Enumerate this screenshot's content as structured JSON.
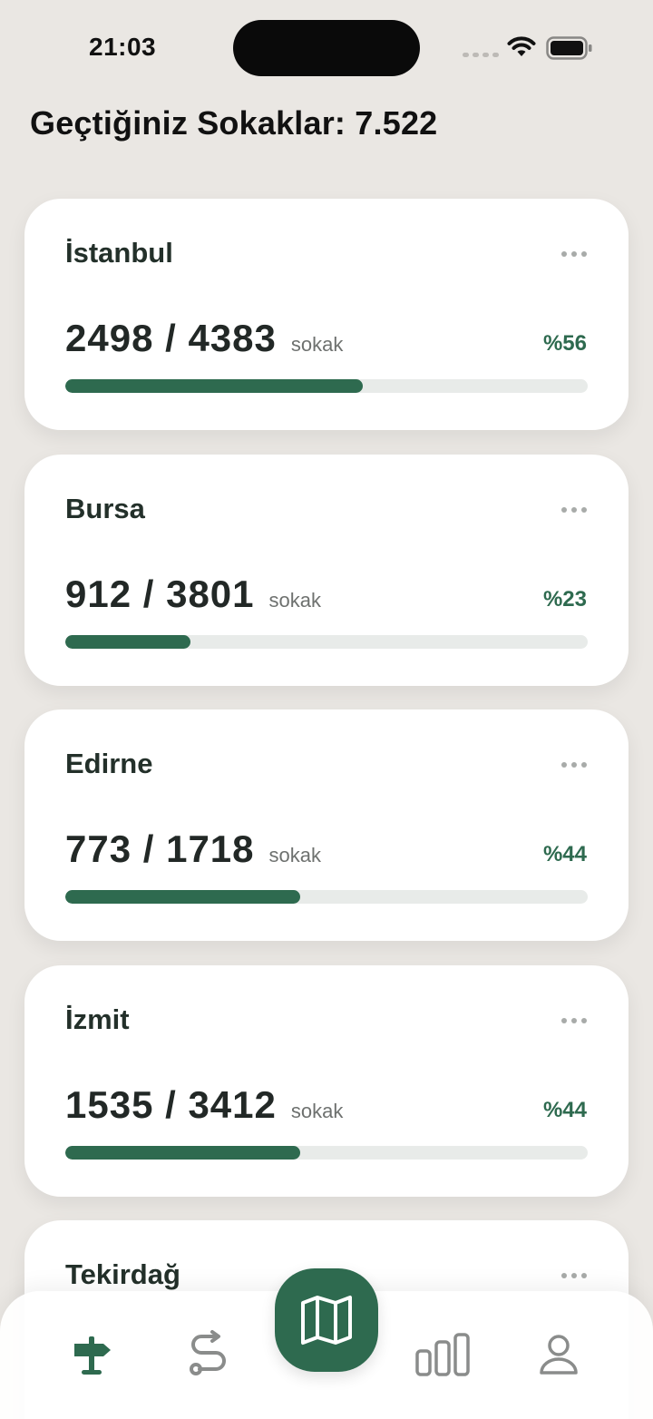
{
  "status": {
    "time": "21:03"
  },
  "header": {
    "title": "Geçtiğiniz Sokaklar: 7.522"
  },
  "cities": [
    {
      "name": "İstanbul",
      "count": "2498 / 4383",
      "unit": "sokak",
      "percent_label": "%56",
      "progress": 0.57
    },
    {
      "name": "Bursa",
      "count": "912 / 3801",
      "unit": "sokak",
      "percent_label": "%23",
      "progress": 0.24
    },
    {
      "name": "Edirne",
      "count": "773 / 1718",
      "unit": "sokak",
      "percent_label": "%44",
      "progress": 0.45
    },
    {
      "name": "İzmit",
      "count": "1535 / 3412",
      "unit": "sokak",
      "percent_label": "%44",
      "progress": 0.45
    },
    {
      "name": "Tekirdağ",
      "count": "",
      "unit": "",
      "percent_label": "",
      "progress": 0
    }
  ],
  "tabs": [
    {
      "icon": "signpost-icon",
      "active": true
    },
    {
      "icon": "route-icon",
      "active": false
    },
    {
      "icon": "map-icon",
      "active": false
    },
    {
      "icon": "bar-chart-icon",
      "active": false
    },
    {
      "icon": "user-icon",
      "active": false
    }
  ],
  "colors": {
    "accent": "#2E6A4F",
    "background": "#EAE7E3",
    "card": "#FFFFFF",
    "track": "#E8EBE9"
  }
}
